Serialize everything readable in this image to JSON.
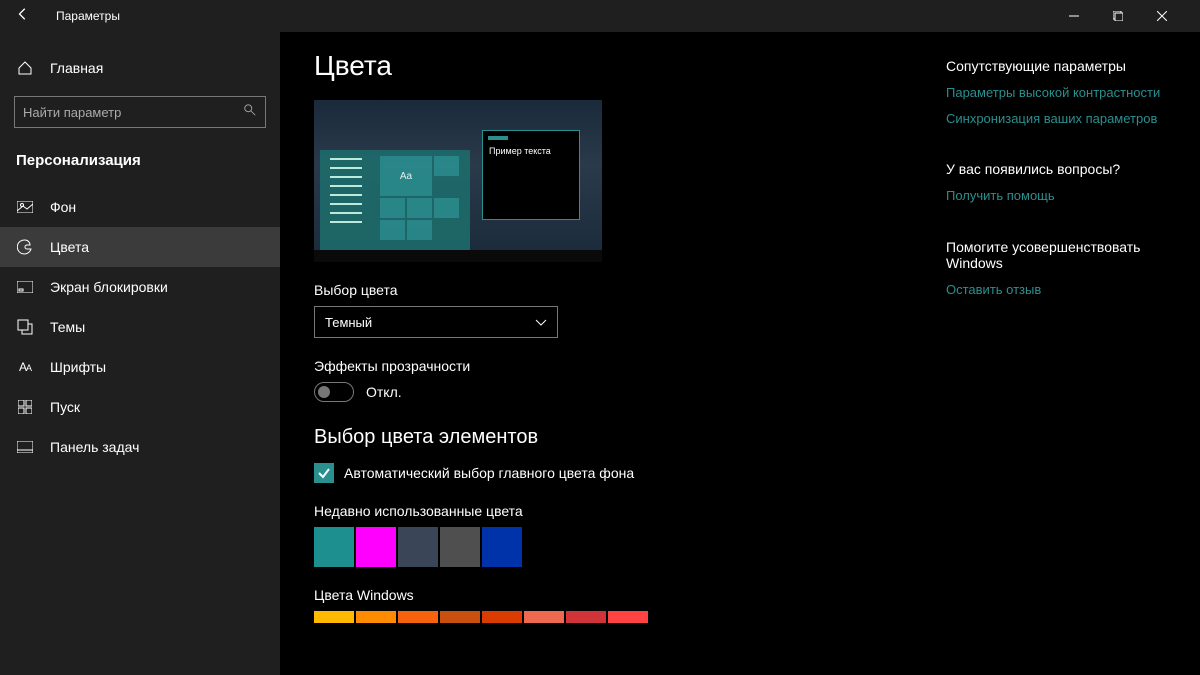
{
  "titlebar": {
    "title": "Параметры"
  },
  "sidebar": {
    "home": "Главная",
    "search_placeholder": "Найти параметр",
    "section": "Персонализация",
    "items": [
      {
        "label": "Фон"
      },
      {
        "label": "Цвета"
      },
      {
        "label": "Экран блокировки"
      },
      {
        "label": "Темы"
      },
      {
        "label": "Шрифты"
      },
      {
        "label": "Пуск"
      },
      {
        "label": "Панель задач"
      }
    ]
  },
  "main": {
    "title": "Цвета",
    "preview_sample_text": "Пример текста",
    "preview_aa": "Aa",
    "choose_color_label": "Выбор цвета",
    "choose_color_value": "Темный",
    "transparency_label": "Эффекты прозрачности",
    "transparency_state": "Откл.",
    "accent_heading": "Выбор цвета элементов",
    "auto_accent_label": "Автоматический выбор главного цвета фона",
    "recent_label": "Недавно использованные цвета",
    "windows_colors_label": "Цвета Windows",
    "recent_colors": [
      "#1e8f8f",
      "#ff00ff",
      "#3a4558",
      "#4f4f4f",
      "#0033aa"
    ],
    "windows_colors": [
      "#ffb900",
      "#ff8c00",
      "#f7630c",
      "#ca5010",
      "#da3b01",
      "#ef6950",
      "#d13438",
      "#ff4343"
    ]
  },
  "right": {
    "related_heading": "Сопутствующие параметры",
    "related_links": [
      "Параметры высокой контрастности",
      "Синхронизация ваших параметров"
    ],
    "questions_heading": "У вас появились вопросы?",
    "help_link": "Получить помощь",
    "improve_heading": "Помогите усовершенствовать Windows",
    "feedback_link": "Оставить отзыв"
  }
}
